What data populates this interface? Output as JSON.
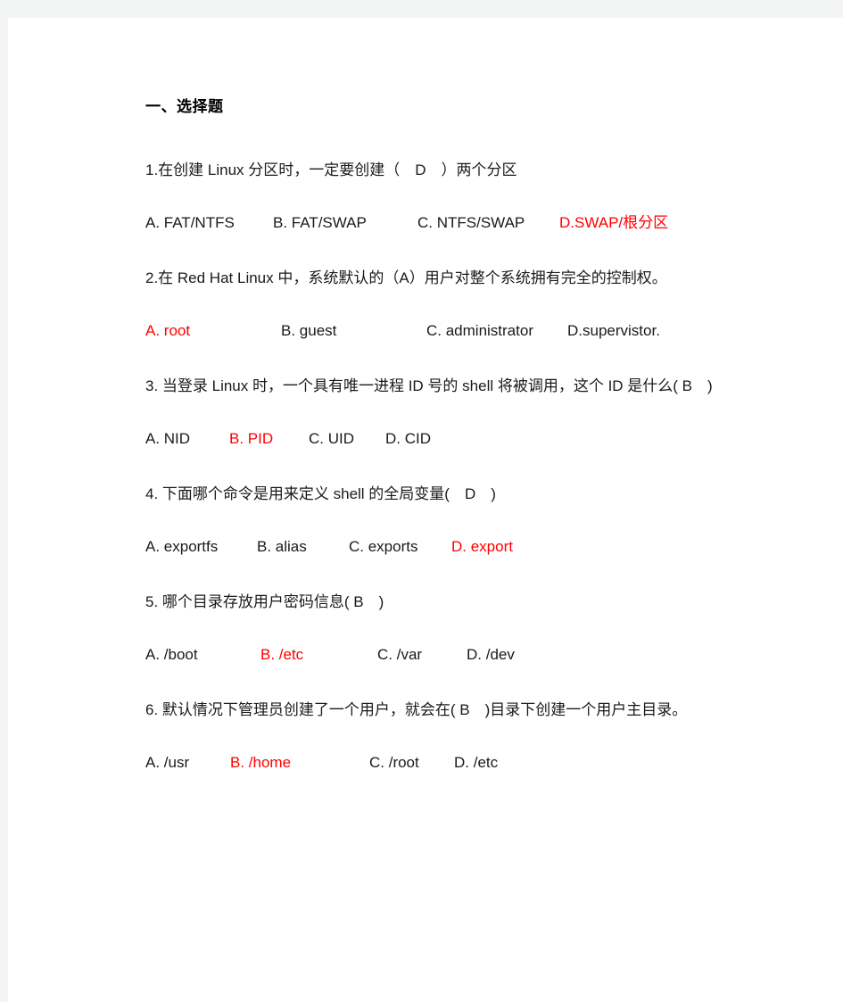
{
  "document": {
    "section_heading": "一、选择题",
    "accent_color": "#ff0000",
    "text_color": "#1a1a1a",
    "page_background": "#ffffff",
    "backdrop_color": "#f3f4f4"
  },
  "questions": [
    {
      "number": "1",
      "text": "1.在创建 Linux 分区时，一定要创建（　D　）两个分区",
      "answer": "D",
      "options": [
        {
          "label": "A. FAT/NTFS",
          "correct": false
        },
        {
          "label": "B. FAT/SWAP",
          "correct": false
        },
        {
          "label": "C. NTFS/SWAP",
          "correct": false
        },
        {
          "label": "D.SWAP/根分区",
          "correct": true
        }
      ]
    },
    {
      "number": "2",
      "text": "2.在 Red Hat Linux 中，系统默认的（A）用户对整个系统拥有完全的控制权。",
      "answer": "A",
      "options": [
        {
          "label": "A. root",
          "correct": true
        },
        {
          "label": "B. guest",
          "correct": false
        },
        {
          "label": "C. administrator",
          "correct": false
        },
        {
          "label": "D.supervistor.",
          "correct": false
        }
      ]
    },
    {
      "number": "3",
      "text": "3. 当登录 Linux 时，一个具有唯一进程 ID 号的 shell 将被调用，这个 ID 是什么( B　)",
      "answer": "B",
      "options": [
        {
          "label": "A. NID",
          "correct": false
        },
        {
          "label": "B. PID",
          "correct": true
        },
        {
          "label": "C. UID",
          "correct": false
        },
        {
          "label": "D. CID",
          "correct": false
        }
      ]
    },
    {
      "number": "4",
      "text": "4. 下面哪个命令是用来定义 shell 的全局变量(　D　)",
      "answer": "D",
      "options": [
        {
          "label": "A. exportfs",
          "correct": false
        },
        {
          "label": "B. alias",
          "correct": false
        },
        {
          "label": "C. exports",
          "correct": false
        },
        {
          "label": "D. export",
          "correct": true
        }
      ]
    },
    {
      "number": "5",
      "text": "5. 哪个目录存放用户密码信息( B　)",
      "answer": "B",
      "options": [
        {
          "label": "A. /boot",
          "correct": false
        },
        {
          "label": "B. /etc",
          "correct": true
        },
        {
          "label": "C. /var",
          "correct": false
        },
        {
          "label": "D. /dev",
          "correct": false
        }
      ]
    },
    {
      "number": "6",
      "text": "6. 默认情况下管理员创建了一个用户，就会在( B　)目录下创建一个用户主目录。",
      "answer": "B",
      "options": [
        {
          "label": "A. /usr",
          "correct": false
        },
        {
          "label": "B. /home",
          "correct": true
        },
        {
          "label": "C. /root",
          "correct": false
        },
        {
          "label": "D. /etc",
          "correct": false
        }
      ]
    }
  ]
}
